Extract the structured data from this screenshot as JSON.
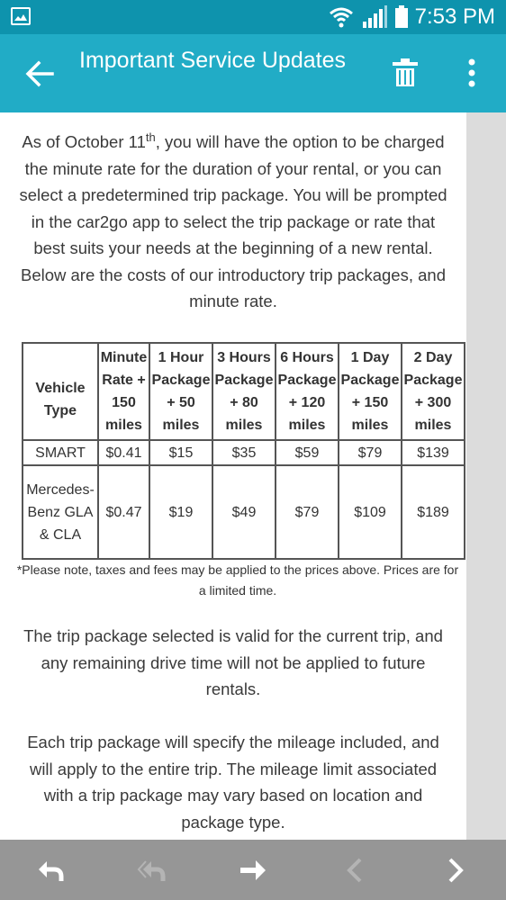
{
  "status_bar": {
    "time": "7:53 PM",
    "icons": [
      "gallery-icon",
      "wifi-icon",
      "signal-icon",
      "battery-icon"
    ]
  },
  "app_bar": {
    "title": "Important Service Updates",
    "icons": [
      "arrow-left-icon",
      "trash-icon",
      "more-vertical-icon"
    ]
  },
  "content": {
    "intro_pre": "As of October 11",
    "intro_sup": "th",
    "intro_post": ", you will have the option to be charged the minute rate for the duration of your rental, or you can select a predetermined trip package. You will be prompted in the car2go app to select the trip package or rate that best suits your needs at the beginning of a new rental. Below are the costs of our introductory trip packages, and minute rate.",
    "table": {
      "headers": [
        "Vehicle Type",
        "Minute Rate + 150 miles",
        "1 Hour Package + 50 miles",
        "3 Hours Package + 80 miles",
        "6 Hours Package + 120 miles",
        "1 Day Package + 150 miles",
        "2 Day Package + 300 miles"
      ],
      "rows": [
        [
          "SMART",
          "$0.41",
          "$15",
          "$35",
          "$59",
          "$79",
          "$139"
        ],
        [
          "Mercedes-Benz GLA & CLA",
          "$0.47",
          "$19",
          "$49",
          "$79",
          "$109",
          "$189"
        ]
      ]
    },
    "note": "*Please note, taxes and fees may be applied to the prices above. Prices are for a limited time.",
    "paragraph2": "The trip package selected is valid for the current trip, and any remaining drive time will not be applied to future rentals.",
    "paragraph3": "Each trip package will specify the mileage included, and will apply to the entire trip. The mileage limit associated with a trip package may vary based on location and package type."
  },
  "bottom_bar": {
    "icons": [
      "reply-icon",
      "reply-all-icon",
      "forward-icon",
      "previous-icon",
      "next-icon"
    ]
  },
  "colors": {
    "status_bar_bg": "#0e93ad",
    "app_bar_bg": "#21acc6",
    "bottom_bar_bg": "#969696",
    "scroll_track": "#dcdcdc"
  }
}
